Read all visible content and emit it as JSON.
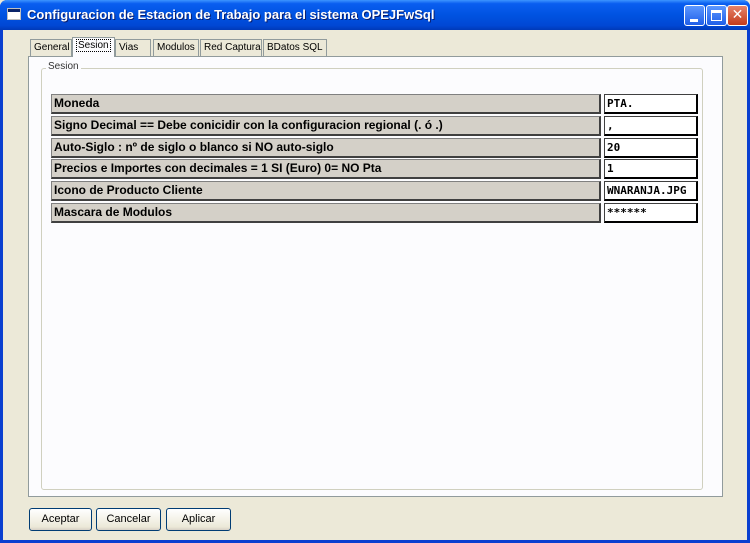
{
  "window": {
    "title": "Configuracion de Estacion de Trabajo para el sistema OPEJFwSql"
  },
  "tabs": [
    {
      "label": "General"
    },
    {
      "label": "Sesion",
      "active": true
    },
    {
      "label": "Vias"
    },
    {
      "label": "Modulos"
    },
    {
      "label": "Red Captura"
    },
    {
      "label": "BDatos SQL"
    }
  ],
  "group": {
    "label": "Sesion"
  },
  "rows": [
    {
      "label": "Moneda",
      "value": "PTA."
    },
    {
      "label": "Signo Decimal == Debe conicidir con la configuracion regional (. ó .)",
      "value": ","
    },
    {
      "label": "Auto-Siglo : nº de siglo o blanco si NO auto-siglo",
      "value": "20"
    },
    {
      "label": "Precios e Importes con decimales = 1 SI (Euro) 0= NO Pta",
      "value": "1"
    },
    {
      "label": "Icono de Producto Cliente",
      "value": "WNARANJA.JPG"
    },
    {
      "label": "Mascara de Modulos",
      "value": "******"
    }
  ],
  "buttons": {
    "accept": "Aceptar",
    "cancel": "Cancelar",
    "apply": "Aplicar"
  }
}
